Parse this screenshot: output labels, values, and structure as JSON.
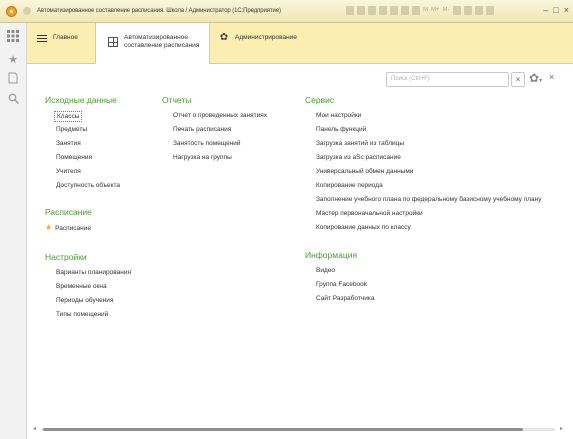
{
  "window": {
    "title": "Автоматизированное составление расписания. Школа / Администратор (1С:Предприятие)",
    "toolbar_text": [
      "M",
      "M+",
      "M-"
    ],
    "buttons": {
      "minimize": "–",
      "restore": "□",
      "close": "×"
    }
  },
  "sidebar": {
    "icons": [
      "apps-grid-icon",
      "favorites-star-icon",
      "history-icon",
      "search-icon"
    ]
  },
  "sections": [
    {
      "label": "Главное",
      "icon": "menu-icon"
    },
    {
      "label": "Автоматизированное составление расписания",
      "line1": "Автоматизированное",
      "line2": "составление расписания",
      "icon": "grid-icon",
      "active": true
    },
    {
      "label": "Администрирование",
      "icon": "gear-icon"
    }
  ],
  "search": {
    "placeholder": "Поиск (Ctrl+F)",
    "clear": "×"
  },
  "form_close": "×",
  "groups": {
    "source_data": {
      "title": "Исходные данные",
      "items": [
        "Классы",
        "Предметы",
        "Занятия",
        "Помещения",
        "Учителя",
        "Доступность объекта"
      ]
    },
    "schedule": {
      "title": "Расписание",
      "items": [
        "Расписание"
      ]
    },
    "settings": {
      "title": "Настройки",
      "items": [
        "Варианты планирования",
        "Временные окна",
        "Периоды обучения",
        "Типы помещений"
      ]
    },
    "reports": {
      "title": "Отчеты",
      "items": [
        "Отчет о проведенных занятиях",
        "Печать расписания",
        "Занятость помещений",
        "Нагрузка на группы"
      ]
    },
    "service": {
      "title": "Сервис",
      "items": [
        "Мои настройки",
        "Панель функций",
        "Загрузка занятий из таблицы",
        "Загрузка из aSc расписание",
        "Универсальный обмен данными",
        "Копирование периода",
        "Заполнение учебного плана по федеральному базисному учебному плану",
        "Мастер первоначальной настройки",
        "Копирование данных по классу"
      ]
    },
    "info": {
      "title": "Информация",
      "items": [
        "Видео",
        "Группа Facebook",
        "Сайт Разработчика"
      ]
    }
  },
  "colors": {
    "group_title": "#4a9e2e",
    "tabs_bg": "#fbeeb0",
    "star": "#f0a53a"
  }
}
